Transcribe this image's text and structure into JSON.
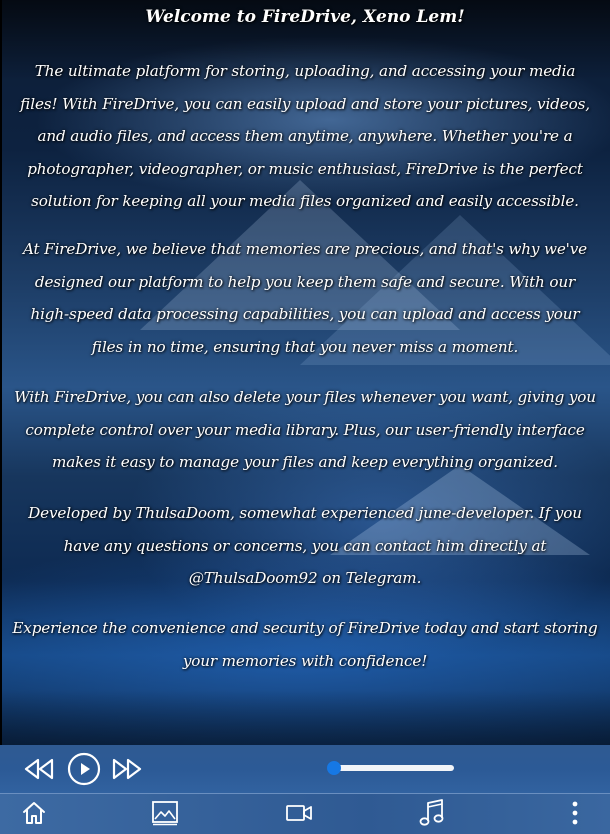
{
  "welcome": {
    "title": "Welcome to FireDrive, Xeno Lem!"
  },
  "about": {
    "paragraphs": [
      {
        "lines": [
          "The ultimate platform for storing, uploading, and accessing your media",
          "files! With FireDrive, you can easily upload and store your pictures, videos,",
          "and audio files, and access them anytime, anywhere. Whether you're a",
          "photographer, videographer, or music enthusiast, FireDrive is the perfect",
          "solution for keeping all your media files organized and easily accessible."
        ]
      },
      {
        "lines": [
          "At FireDrive, we believe that memories are precious, and that's why we've",
          "designed our platform to help you keep them safe and secure. With our",
          "high-speed data processing capabilities, you can upload and access your",
          "files in no time, ensuring that you never miss a moment."
        ]
      },
      {
        "lines": [
          "With FireDrive, you can also delete your files whenever you want, giving you",
          "complete control over your media library. Plus, our user-friendly interface",
          "makes it easy to manage your files and keep everything organized."
        ]
      },
      {
        "lines": [
          "Developed by ThulsaDoom, somewhat experienced june-developer. If you",
          "have any questions or concerns, you can contact him directly at",
          "@ThulsaDoom92 on Telegram."
        ]
      },
      {
        "lines": [
          "Experience the convenience and security of FireDrive today and start storing",
          "your memories with confidence!"
        ]
      }
    ]
  },
  "player": {
    "buttons": [
      "previous-icon",
      "play-icon",
      "next-icon"
    ],
    "progress": 0.03,
    "colors": {
      "track": "#f2f4f8",
      "thumb": "#1678e5",
      "icon": "#ffffff"
    }
  },
  "nav": {
    "items": [
      "home-icon",
      "images-icon",
      "video-icon",
      "music-icon",
      "more-vertical-icon"
    ]
  }
}
